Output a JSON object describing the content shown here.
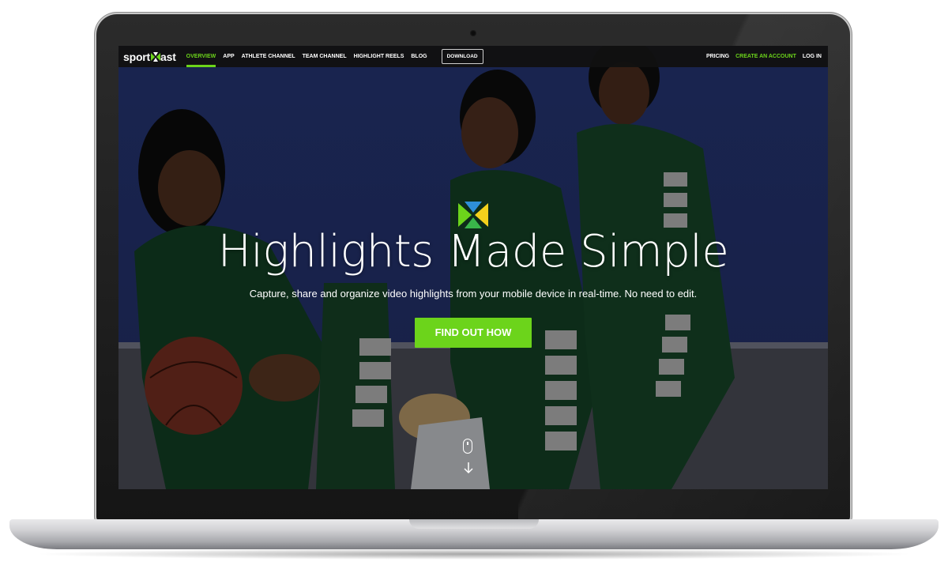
{
  "brand": {
    "logo_text_left": "sport",
    "logo_text_right": "ast",
    "accent_color": "#6cd41b"
  },
  "nav": {
    "items": [
      {
        "label": "OVERVIEW",
        "active": true
      },
      {
        "label": "APP",
        "active": false
      },
      {
        "label": "ATHLETE CHANNEL",
        "active": false
      },
      {
        "label": "TEAM CHANNEL",
        "active": false
      },
      {
        "label": "HIGHLIGHT REELS",
        "active": false
      },
      {
        "label": "BLOG",
        "active": false
      }
    ],
    "download_label": "DOWNLOAD",
    "right": {
      "pricing": "PRICING",
      "create_account": "CREATE AN ACCOUNT",
      "login": "LOG IN"
    }
  },
  "hero": {
    "icon": "sportscast-x-logo-icon",
    "title": "Highlights Made Simple",
    "subtitle": "Capture, share and organize video highlights from your mobile device in real-time. No need to edit.",
    "cta_label": "FIND OUT HOW",
    "scroll_icons": [
      "mouse-scroll-icon",
      "arrow-down-icon"
    ]
  }
}
